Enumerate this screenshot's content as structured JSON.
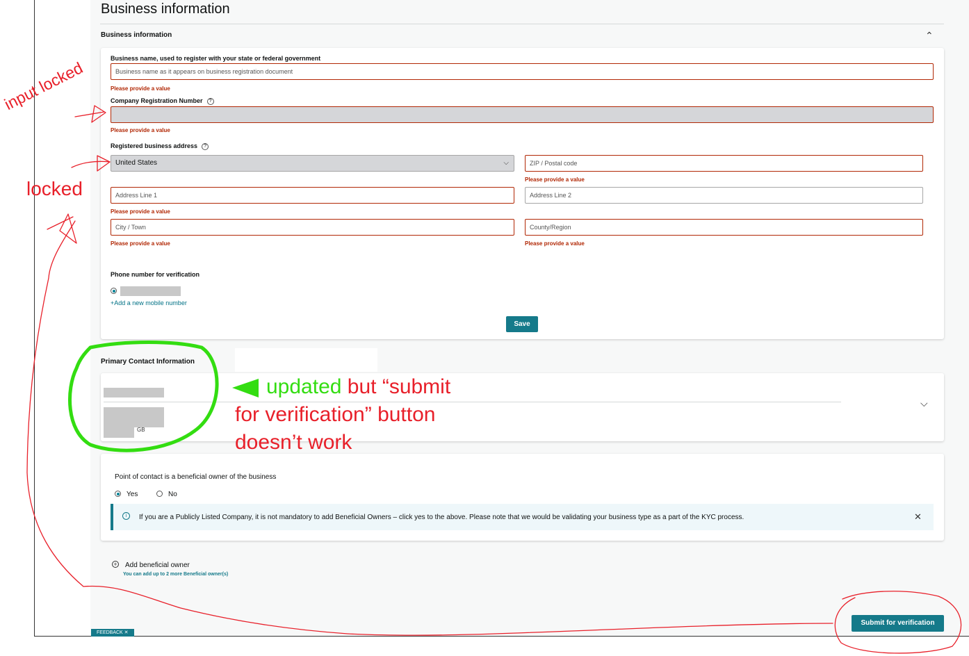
{
  "page": {
    "title": "Business information"
  },
  "business_section": {
    "label": "Business information",
    "business_name_label": "Business name, used to register with your state or federal government",
    "business_name_placeholder": "Business name as it appears on business registration document",
    "business_name_error": "Please provide a value",
    "crn_label": "Company Registration Number",
    "crn_error": "Please provide a value",
    "address_label": "Registered business address",
    "country_value": "United States",
    "zip_placeholder": "ZIP / Postal code",
    "zip_error": "Please provide a value",
    "address1_placeholder": "Address Line 1",
    "address1_error": "Please provide a value",
    "address2_placeholder": "Address Line 2",
    "city_placeholder": "City / Town",
    "city_error": "Please provide a value",
    "county_placeholder": "County/Region",
    "county_error": "Please provide a value",
    "phone_label": "Phone number for verification",
    "add_mobile_link": "+Add a new mobile number",
    "save_button": "Save"
  },
  "contact_section": {
    "label": "Primary Contact Information",
    "country_suffix": "GB"
  },
  "beneficial": {
    "question": "Point of contact is a beneficial owner of the business",
    "yes_label": "Yes",
    "no_label": "No",
    "yes_selected": true,
    "info_text": "If you are a Publicly Listed Company, it is not mandatory to add Beneficial Owners – click yes to the above. Please note that we would be validating your business type as a part of the KYC process.",
    "add_owner_label": "Add beneficial owner",
    "add_owner_hint": "You can add up to 2 more Beneficial owner(s)"
  },
  "footer": {
    "submit_button": "Submit for verification",
    "feedback_label": "FEEDBACK ✕"
  },
  "annotations": {
    "input_locked": "input locked",
    "locked": "locked",
    "updated": "updated",
    "but_submit": " but “submit",
    "line2": "for verification” button",
    "line3": "doesn’t work"
  },
  "colors": {
    "error": "#b12704",
    "teal": "#157a8a",
    "annotation_red": "#e8202a",
    "annotation_green": "#33dd11"
  }
}
